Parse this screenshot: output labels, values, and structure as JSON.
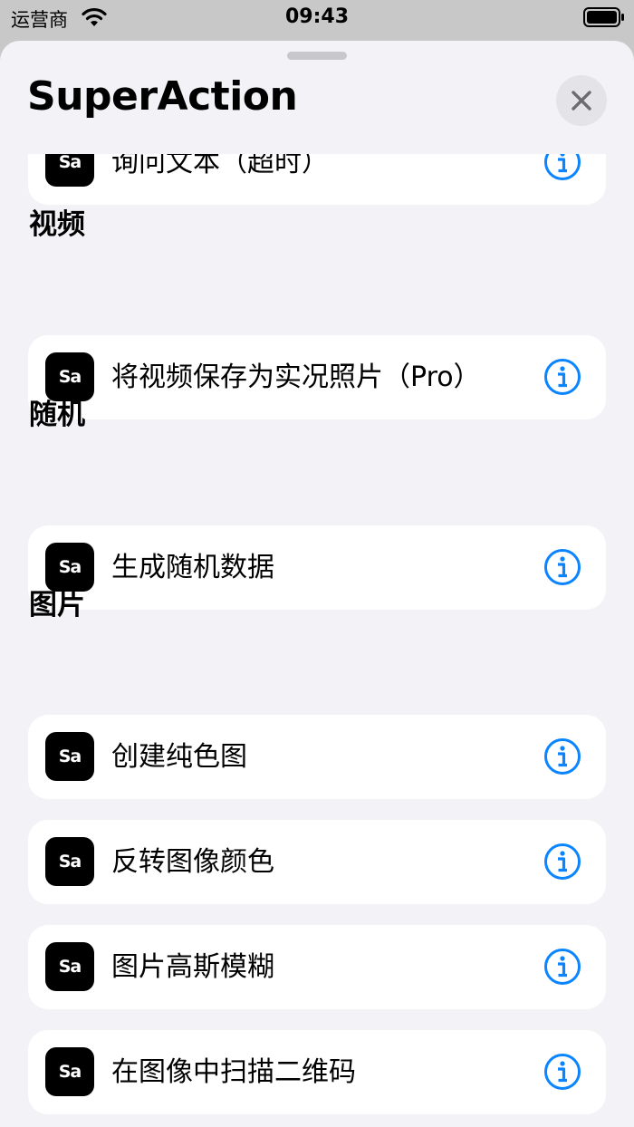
{
  "status_bar": {
    "carrier": "运营商",
    "time": "09:43"
  },
  "sheet": {
    "title": "SuperAction"
  },
  "icon_text": "Sa",
  "colors": {
    "accent": "#0a84ff",
    "background": "#f2f2f7",
    "card": "#ffffff",
    "icon_bg": "#000000"
  },
  "partial_row": {
    "label": "询问文本（超时）"
  },
  "sections": [
    {
      "header": "视频",
      "items": [
        {
          "label": "将视频保存为实况照片（Pro）"
        }
      ]
    },
    {
      "header": "随机",
      "items": [
        {
          "label": "生成随机数据"
        }
      ]
    },
    {
      "header": "图片",
      "items": [
        {
          "label": "创建纯色图"
        },
        {
          "label": "反转图像颜色"
        },
        {
          "label": "图片高斯模糊"
        },
        {
          "label": "在图像中扫描二维码"
        }
      ]
    }
  ]
}
